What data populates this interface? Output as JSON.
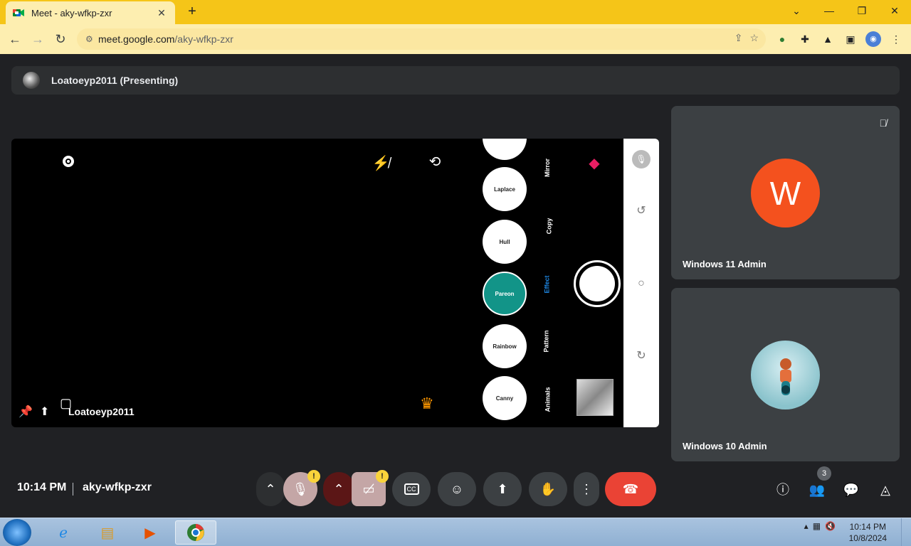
{
  "browser": {
    "tab_title": "Meet - aky-wfkp-zxr",
    "url_host": "meet.google.com",
    "url_path": "/aky-wfkp-zxr"
  },
  "meet": {
    "presenting_title": "Loatoeyp2011 (Presenting)",
    "stage_name": "Loatoeyp2011",
    "filters": [
      "Laplace",
      "Hull",
      "Pareon",
      "Rainbow",
      "Canny"
    ],
    "modes": [
      "Mirror",
      "Copy",
      "Effect",
      "Pattern",
      "Animals"
    ],
    "active_mode": "Effect",
    "participants": [
      {
        "name": "Windows 11 Admin",
        "initial": "W",
        "color": "#f4511e"
      },
      {
        "name": "Windows 10 Admin"
      }
    ],
    "time": "10:14 PM",
    "meeting_code": "aky-wfkp-zxr",
    "people_count": "3",
    "warn_symbol": "!"
  },
  "taskbar": {
    "time": "10:14 PM",
    "date": "10/8/2024"
  }
}
